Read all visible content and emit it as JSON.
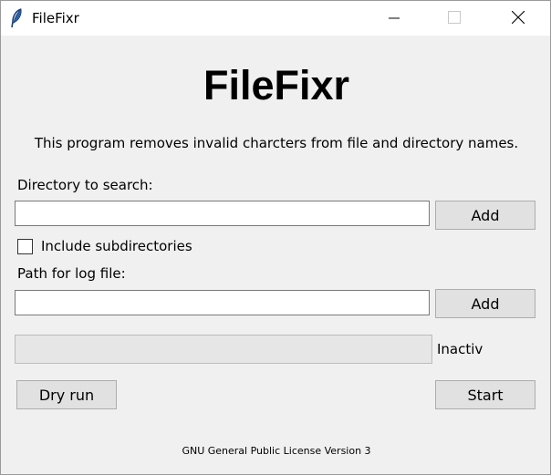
{
  "window": {
    "title": "FileFixr",
    "icon": "feather-icon",
    "controls": [
      "minimize-icon",
      "maximize-icon",
      "close-icon"
    ]
  },
  "header": {
    "app_title": "FileFixr",
    "description": "This program removes invalid charcters from file and directory names."
  },
  "directory": {
    "label": "Directory to search:",
    "value": "",
    "add_label": "Add"
  },
  "subdirectories": {
    "label": "Include subdirectories",
    "checked": false
  },
  "log": {
    "label": "Path for log file:",
    "value": "",
    "add_label": "Add"
  },
  "progress": {
    "value": 0,
    "status": "Inactiv"
  },
  "actions": {
    "dry_run_label": "Dry run",
    "start_label": "Start"
  },
  "footer": {
    "license": "GNU General Public License Version 3"
  }
}
